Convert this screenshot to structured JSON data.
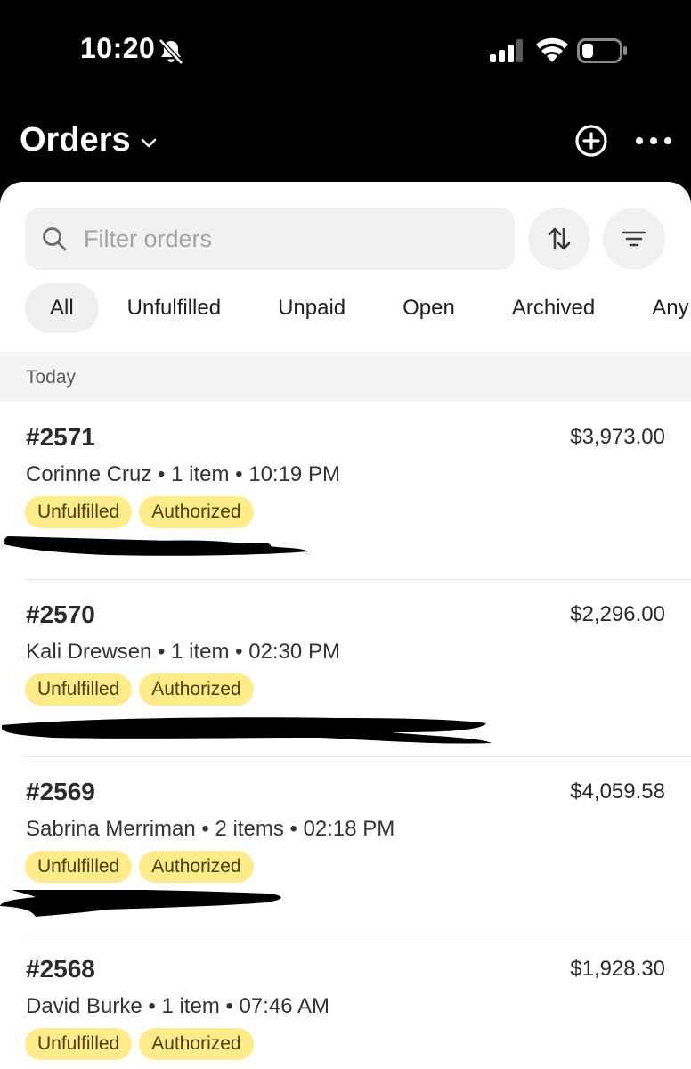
{
  "status_bar": {
    "time": "10:20",
    "icons": [
      "bell-slash-icon",
      "cellular-signal-icon",
      "wifi-icon",
      "battery-icon"
    ]
  },
  "header": {
    "title": "Orders",
    "icons": [
      "chevron-down-icon",
      "plus-circle-icon",
      "more-horizontal-icon"
    ]
  },
  "search": {
    "placeholder": "Filter orders",
    "value": ""
  },
  "toolbar_icons": [
    "sort-arrows-icon",
    "filter-lines-icon"
  ],
  "tabs": [
    {
      "label": "All",
      "active": true
    },
    {
      "label": "Unfulfilled",
      "active": false
    },
    {
      "label": "Unpaid",
      "active": false
    },
    {
      "label": "Open",
      "active": false
    },
    {
      "label": "Archived",
      "active": false
    },
    {
      "label": "Any",
      "active": false
    }
  ],
  "section": {
    "label": "Today"
  },
  "orders": [
    {
      "number": "#2571",
      "total": "$3,973.00",
      "meta": "Corinne Cruz • 1 item • 10:19 PM",
      "badges": [
        "Unfulfilled",
        "Authorized"
      ]
    },
    {
      "number": "#2570",
      "total": "$2,296.00",
      "meta": "Kali Drewsen • 1 item • 02:30 PM",
      "badges": [
        "Unfulfilled",
        "Authorized"
      ]
    },
    {
      "number": "#2569",
      "total": "$4,059.58",
      "meta": "Sabrina Merriman • 2 items • 02:18 PM",
      "badges": [
        "Unfulfilled",
        "Authorized"
      ]
    },
    {
      "number": "#2568",
      "total": "$1,928.30",
      "meta": "David Burke • 1 item • 07:46 AM",
      "badges": [
        "Unfulfilled",
        "Authorized"
      ]
    }
  ],
  "colors": {
    "background_dark": "#000000",
    "sheet": "#ffffff",
    "badge_bg": "#ffeb8a",
    "badge_text": "#4a3f00",
    "chip_bg": "#efefef",
    "section_bg": "#f4f4f4"
  }
}
